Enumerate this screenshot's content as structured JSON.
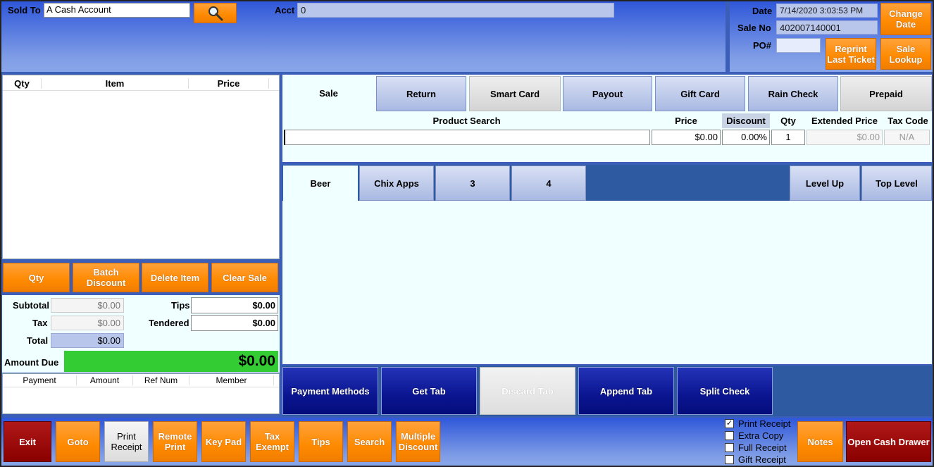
{
  "header": {
    "sold_to_label": "Sold To",
    "sold_to_value": "A Cash Account",
    "acct_label": "Acct",
    "acct_value": "0",
    "date_label": "Date",
    "date_value": "7/14/2020 3:03:53 PM",
    "sale_no_label": "Sale No",
    "sale_no_value": "402007140001",
    "po_label": "PO#",
    "po_value": "",
    "change_date_label": "Change\nDate",
    "reprint_label": "Reprint\nLast Ticket",
    "sale_lookup_label": "Sale\nLookup"
  },
  "cart": {
    "columns": [
      "Qty",
      "Item",
      "Price"
    ],
    "rows": []
  },
  "cart_actions": [
    "Qty",
    "Batch Discount",
    "Delete Item",
    "Clear Sale"
  ],
  "totals": {
    "subtotal_label": "Subtotal",
    "subtotal_value": "$0.00",
    "tax_label": "Tax",
    "tax_value": "$0.00",
    "total_label": "Total",
    "total_value": "$0.00",
    "tips_label": "Tips",
    "tips_value": "$0.00",
    "tendered_label": "Tendered",
    "tendered_value": "$0.00",
    "amount_due_label": "Amount Due",
    "amount_due_value": "$0.00"
  },
  "payments": {
    "columns": [
      "Payment",
      "Amount",
      "Ref Num",
      "Member"
    ]
  },
  "sale_tabs": [
    "Sale",
    "Return",
    "Smart Card",
    "Payout",
    "Gift Card",
    "Rain Check",
    "Prepaid"
  ],
  "product_search": {
    "search_label": "Product Search",
    "search_value": "",
    "price_label": "Price",
    "price_value": "$0.00",
    "discount_label": "Discount",
    "discount_value": "0.00%",
    "qty_label": "Qty",
    "qty_value": "1",
    "ext_price_label": "Extended Price",
    "ext_price_value": "$0.00",
    "tax_code_label": "Tax Code",
    "tax_code_value": "N/A"
  },
  "category_tabs": [
    "Beer",
    "Chix Apps",
    "3",
    "4"
  ],
  "level_buttons": [
    "Level Up",
    "Top Level"
  ],
  "tab_buttons": [
    "Payment Methods",
    "Get Tab",
    "Discard Tab",
    "Append Tab",
    "Split Check"
  ],
  "footer": {
    "exit": "Exit",
    "goto": "Goto",
    "print_receipt": "Print\nReceipt",
    "remote_print": "Remote\nPrint",
    "key_pad": "Key Pad",
    "tax_exempt": "Tax\nExempt",
    "tips": "Tips",
    "search": "Search",
    "multiple_discount": "Multiple\nDiscount",
    "checkboxes": [
      {
        "label": "Print Receipt",
        "checked": true
      },
      {
        "label": "Extra Copy",
        "checked": false
      },
      {
        "label": "Full Receipt",
        "checked": false
      },
      {
        "label": "Gift Receipt",
        "checked": false
      }
    ],
    "notes": "Notes",
    "open_cash_drawer": "Open Cash Drawer"
  },
  "colors": {
    "accent_orange": "#ff8a00",
    "exit_red": "#8a0000",
    "navy": "#0a1590",
    "amount_due_green": "#33cc33",
    "panel_light": "#f0ffff"
  }
}
